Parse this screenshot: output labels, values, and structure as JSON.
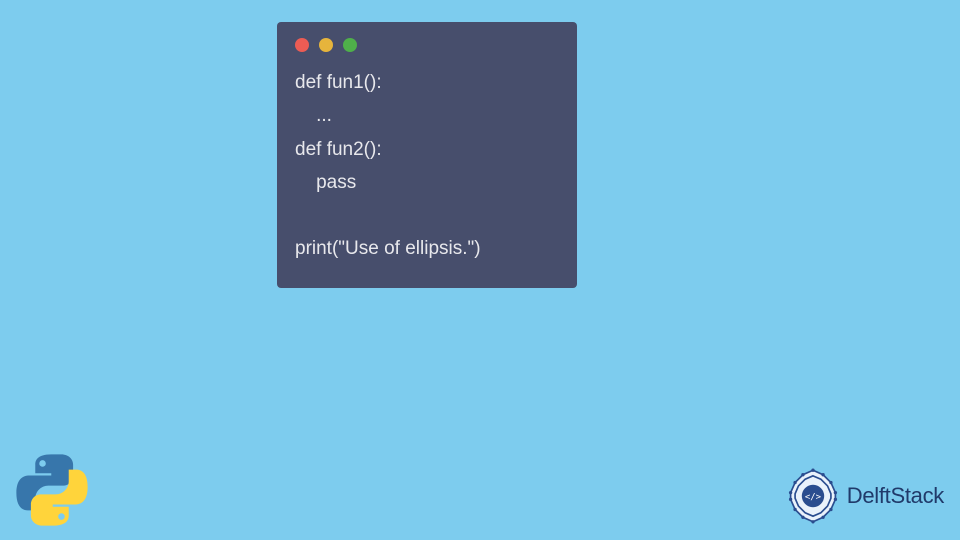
{
  "code": {
    "lines": [
      "def fun1():",
      "    ...",
      "def fun2():",
      "    pass",
      "",
      "print(\"Use of ellipsis.\")"
    ]
  },
  "traffic_lights": {
    "red": "#ec5c54",
    "yellow": "#e6b43c",
    "green": "#4fb04a"
  },
  "branding": {
    "name": "DelftStack",
    "python_logo_colors": {
      "top": "#3776ab",
      "bottom": "#ffd43b"
    },
    "delft_icon_color": "#2a4d8f"
  },
  "background": "#7dccee",
  "window_bg": "#474e6c"
}
